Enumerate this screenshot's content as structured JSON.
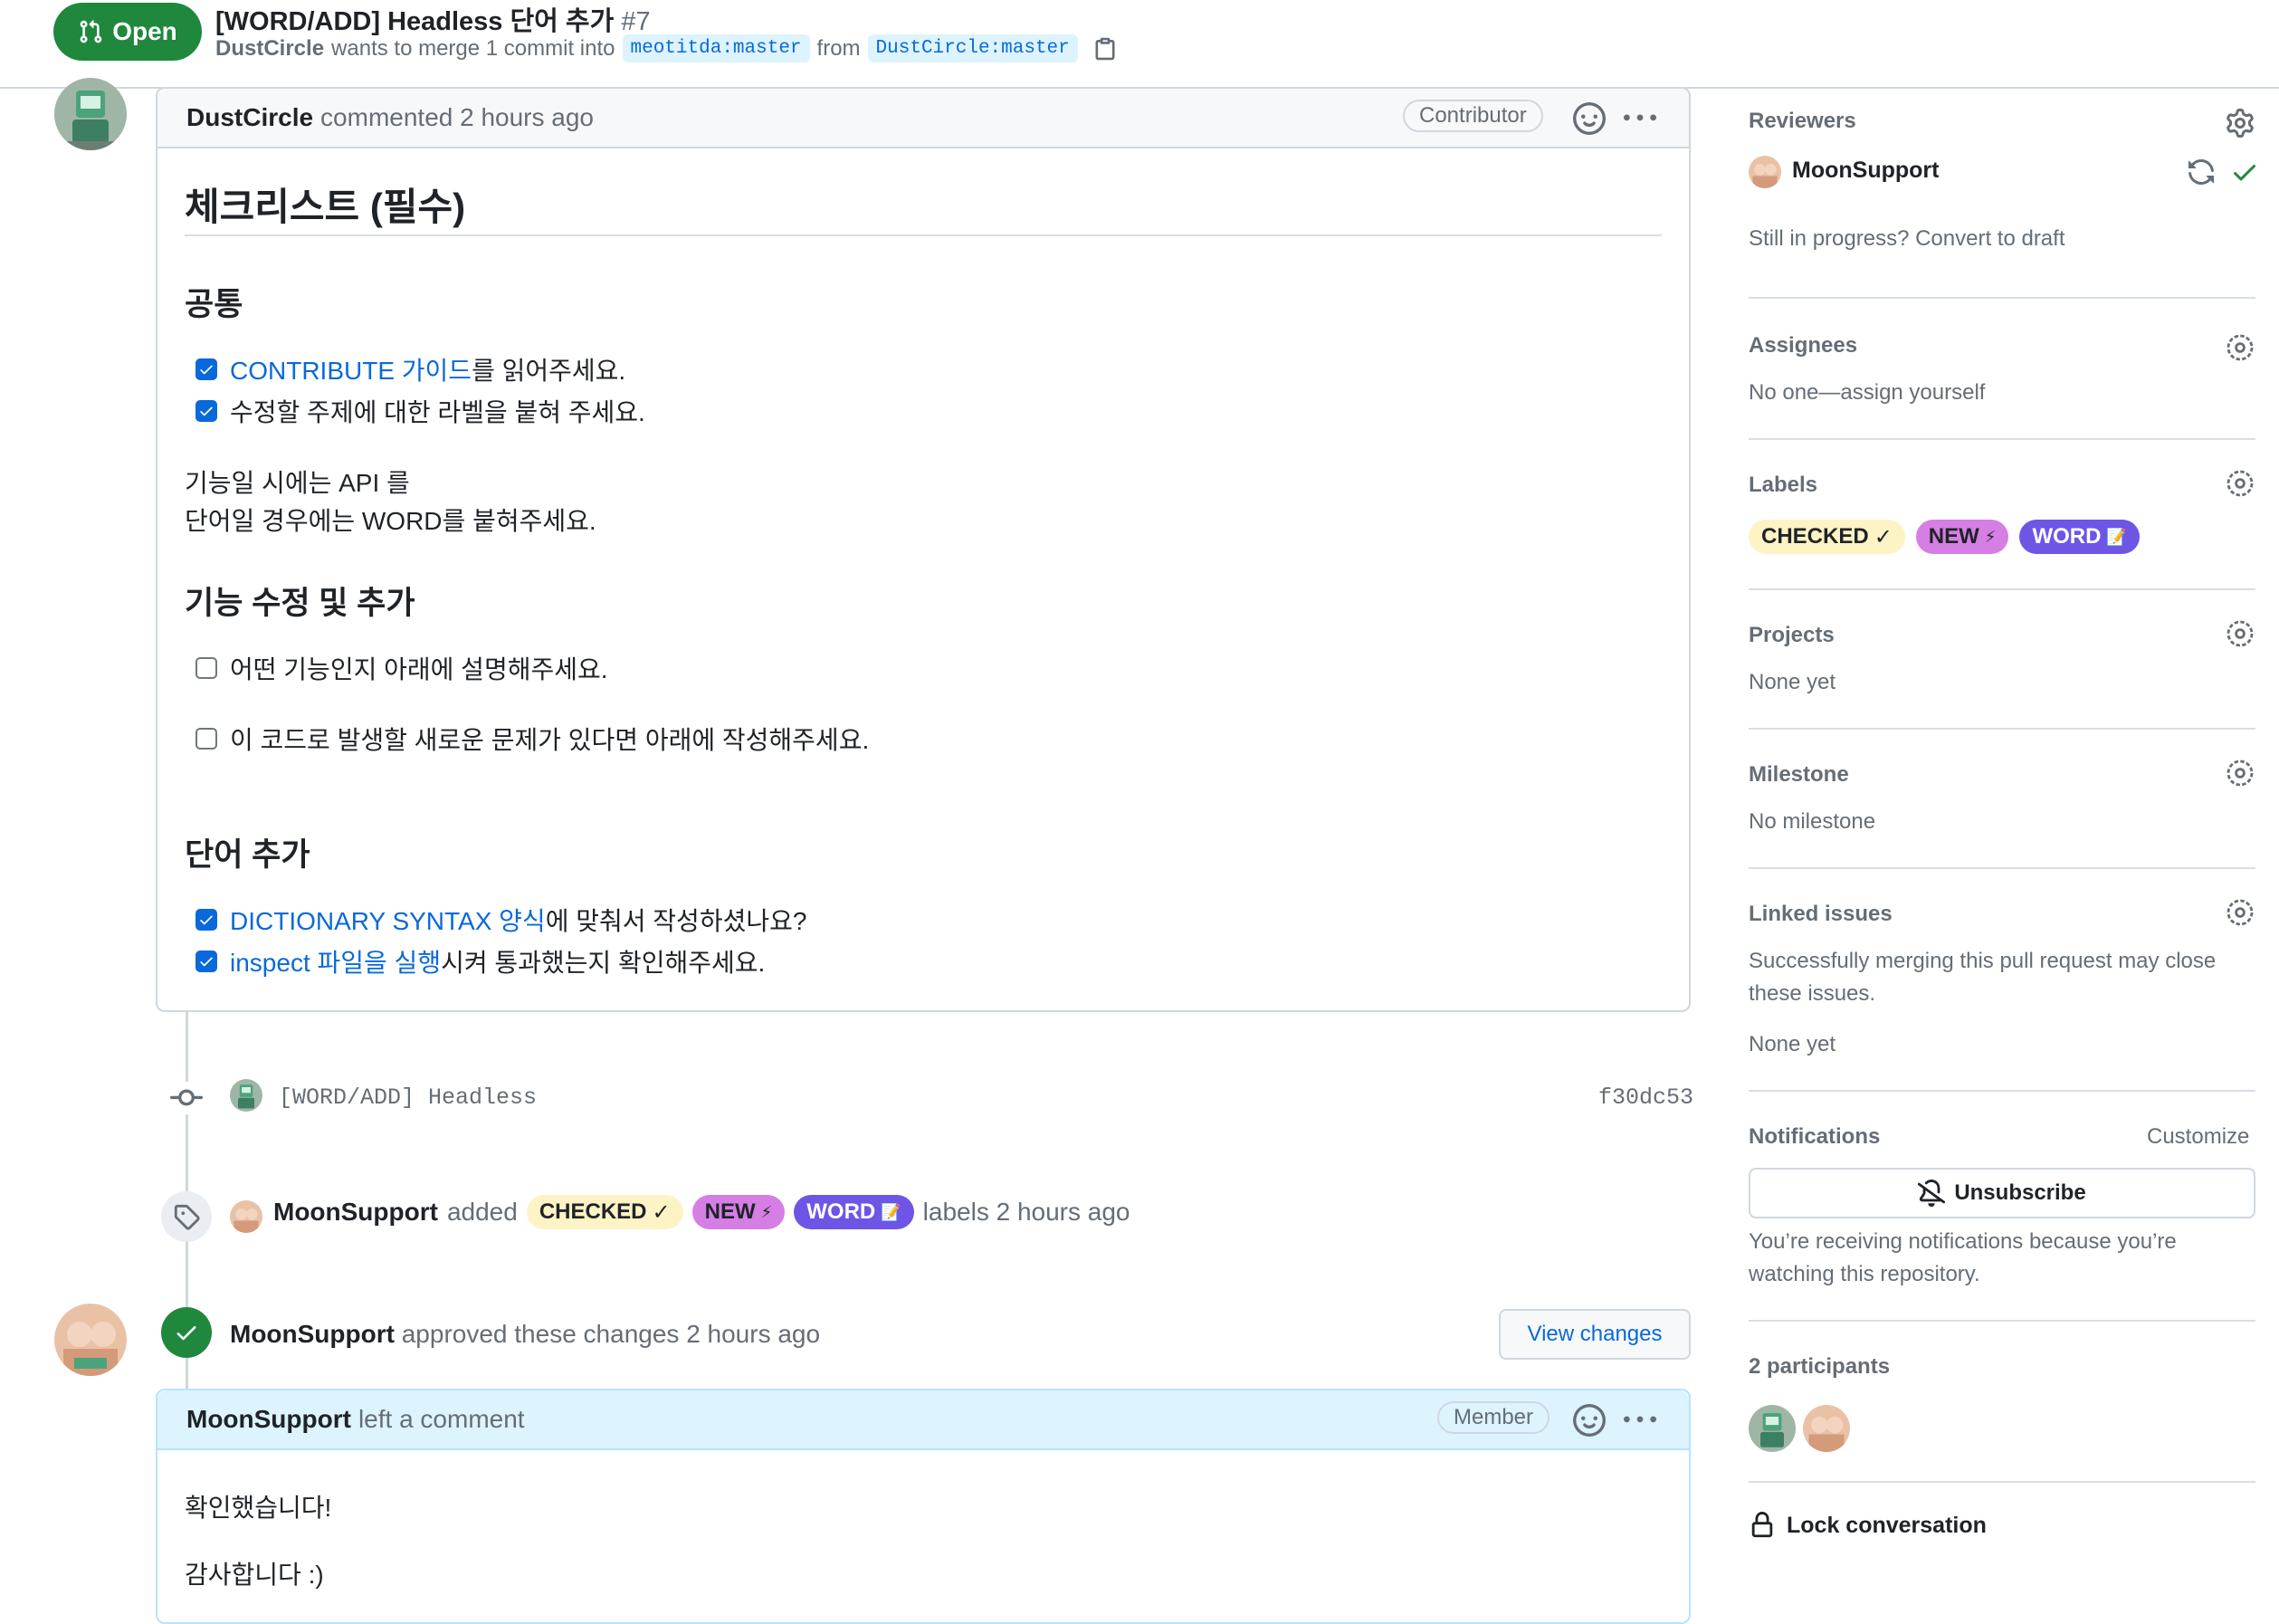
{
  "header": {
    "state_label": "Open",
    "title": "[WORD/ADD] Headless 단어 추가",
    "number": "#7",
    "author": "DustCircle",
    "merge_text": "wants to merge 1 commit into",
    "base_branch": "meotitda:master",
    "from_text": "from",
    "head_branch": "DustCircle:master"
  },
  "comment1": {
    "author": "DustCircle",
    "meta": "commented 2 hours ago",
    "role": "Contributor",
    "h1": "체크리스트 (필수)",
    "sec_common": "공통",
    "task1_link": "CONTRIBUTE 가이드",
    "task1_rest": "를 읽어주세요.",
    "task2": "수정할 주제에 대한 라벨을 붙혀 주세요.",
    "para1": "기능일 시에는 API 를",
    "para2": "단어일 경우에는 WORD를 붙혀주세요.",
    "sec_feature": "기능 수정 및 추가",
    "task3": "어떤 기능인지 아래에 설명해주세요.",
    "task4": "이 코드로 발생할 새로운 문제가 있다면 아래에 작성해주세요.",
    "sec_word": "단어 추가",
    "task5_link": "DICTIONARY SYNTAX 양식",
    "task5_rest": "에 맞춰서 작성하셨나요?",
    "task6_link": "inspect 파일을 실행",
    "task6_rest": "시켜 통과했는지 확인해주세요."
  },
  "commit": {
    "message": "[WORD/ADD] Headless",
    "sha": "f30dc53"
  },
  "label_event": {
    "actor": "MoonSupport",
    "verb": "added",
    "suffix": "labels 2 hours ago"
  },
  "labels": [
    {
      "name": "CHECKED",
      "emoji": "✓",
      "color": "#fdf3c5"
    },
    {
      "name": "NEW",
      "emoji": "⚡",
      "color": "#d57ee4"
    },
    {
      "name": "WORD",
      "emoji": "📝",
      "color": "#6e55e6"
    }
  ],
  "review": {
    "actor": "MoonSupport",
    "text": "approved these changes 2 hours ago",
    "button": "View changes"
  },
  "comment2": {
    "author": "MoonSupport",
    "meta": "left a comment",
    "role": "Member",
    "line1": "확인했습니다!",
    "line2": "감사합니다 :)"
  },
  "sidebar": {
    "reviewers_title": "Reviewers",
    "reviewer_name": "MoonSupport",
    "draft_text": "Still in progress? Convert to draft",
    "assignees_title": "Assignees",
    "assignees_text": "No one—assign yourself",
    "labels_title": "Labels",
    "projects_title": "Projects",
    "projects_text": "None yet",
    "milestone_title": "Milestone",
    "milestone_text": "No milestone",
    "linked_title": "Linked issues",
    "linked_text1": "Successfully merging this pull request may close",
    "linked_text2": "these issues.",
    "linked_none": "None yet",
    "notifications_title": "Notifications",
    "customize": "Customize",
    "unsubscribe": "Unsubscribe",
    "notif_text1": "You’re receiving notifications because you’re",
    "notif_text2": "watching this repository.",
    "participants_title": "2 participants",
    "lock": "Lock conversation"
  },
  "colors": {
    "open_green": "#1f883d",
    "link_blue": "#0969da",
    "muted": "#656d76"
  }
}
